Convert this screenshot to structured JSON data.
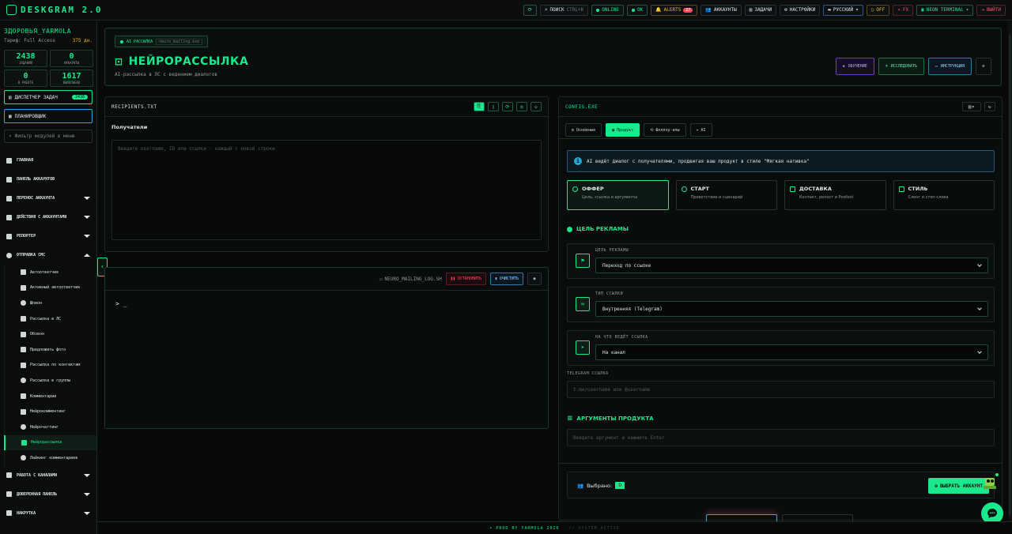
{
  "app": {
    "logo_text": "DESKGRAM 2.0",
    "brand_color": "#19e88d"
  },
  "topbar": {
    "search_label": "ПОИСК",
    "search_shortcut": "CTRL+K",
    "online_label": "ONLINE",
    "ok_label": "OK",
    "alerts_label": "ALERTS",
    "alerts_count": "27",
    "accounts_label": "АККАУНТЫ",
    "tasks_label": "ЗАДАЧИ",
    "settings_label": "НАСТРОЙКИ",
    "language_label": "РУССКИЙ",
    "off_label": "OFF",
    "fx_label": "FX",
    "theme_label": "NEON TERMINAL",
    "logout_label": "ВЫЙТИ"
  },
  "sidebar": {
    "user_name": "ЗДОРОВЬЯ_YARMOLA",
    "tariff": "Тариф: Full Access",
    "days": "375 дн.",
    "stats": [
      {
        "value": "2438",
        "label": "ЗАДАНИЙ"
      },
      {
        "value": "0",
        "label": "АККАУНТЫ"
      },
      {
        "value": "0",
        "label": "В РАБОТЕ"
      },
      {
        "value": "1617",
        "label": "ВЫПОЛНЕНО"
      }
    ],
    "dispatcher_label": "ДИСПЕТЧЕР ЗАДАЧ",
    "dispatcher_count": "2438",
    "planner_label": "ПЛАНИРОВЩИК",
    "filter_placeholder": "Фильтр модулей в меню",
    "nav": [
      {
        "label": "ГЛАВНАЯ",
        "icon": "home-icon"
      },
      {
        "label": "ПАНЕЛЬ АККАУНТОВ",
        "icon": "users-icon"
      },
      {
        "label": "ПЕРЕНОС АККАУНТА",
        "icon": "transfer-icon"
      },
      {
        "label": "ДЕЙСТВИЯ С АККАУНТАМИ",
        "icon": "users-cog-icon"
      },
      {
        "label": "РЕПОРТЕР",
        "icon": "flag-icon"
      },
      {
        "label": "ОТПРАВКА СМС",
        "icon": "chat-icon"
      }
    ],
    "sub": [
      {
        "label": "Автоответчик"
      },
      {
        "label": "Активный автоответчик"
      },
      {
        "label": "Шпион"
      },
      {
        "label": "Рассылка в ЛС"
      },
      {
        "label": "Обзвон"
      },
      {
        "label": "Предложить фото"
      },
      {
        "label": "Рассылка по контактам"
      },
      {
        "label": "Рассылка в группы"
      },
      {
        "label": "Комментарии"
      },
      {
        "label": "Нейрокомментинг"
      },
      {
        "label": "Нейрочаттинг"
      },
      {
        "label": "Нейрорассылка"
      },
      {
        "label": "Лайкинг комментариев"
      }
    ],
    "nav2": [
      {
        "label": "РАБОТА С КАНАЛАМИ"
      },
      {
        "label": "ДОВЕРЕННАЯ ПАНЕЛЬ"
      },
      {
        "label": "НАКРУТКА"
      }
    ]
  },
  "header": {
    "tag": "AI РАССЫЛКА",
    "file": "neuro_mailing.exe",
    "title": "НЕЙРОРАССЫЛКА",
    "subtitle": "AI-рассылка в ЛС с ведением диалогов",
    "btn_learn": "ОБУЧЕНИЕ",
    "btn_explore": "ИССЛЕДОВАТЬ",
    "btn_guide": "ИНСТРУКЦИЯ"
  },
  "recipients": {
    "file": "RECIPIENTS.TXT",
    "label": "Получатели",
    "placeholder": "Введите username, ID или ссылки - каждый с новой строки"
  },
  "log": {
    "file": "NEURO_MAILING_LOG.SH",
    "stop": "ОСТАНОВИТЬ",
    "clear": "ОЧИСТИТЬ",
    "prompt": "> _"
  },
  "config": {
    "file": "CONFIG.EXE",
    "tabs": [
      "Основные",
      "Продукт",
      "Фоллоу-апы",
      "AI"
    ],
    "info": "AI ведёт диалог с получателями, продвигая ваш продукт в стиле \"Мягкая нативка\"",
    "cards": [
      {
        "title": "ОФФЕР",
        "desc": "Цель, ссылка и аргументы"
      },
      {
        "title": "СТАРТ",
        "desc": "Приветствие и сценарий"
      },
      {
        "title": "ДОСТАВКА",
        "desc": "Контакт, репост и Postbot"
      },
      {
        "title": "СТИЛЬ",
        "desc": "Сленг и стоп-слова"
      }
    ],
    "section_goal": "ЦЕЛЬ РЕКЛАМЫ",
    "fields": [
      {
        "label": "ЦЕЛЬ РЕКЛАМЫ",
        "value": "Переход по ссылке"
      },
      {
        "label": "ТИП ССЫЛКИ",
        "value": "Внутренняя (Telegram)"
      },
      {
        "label": "НА ЧТО ВЕДЁТ ССЫЛКА",
        "value": "На канал"
      }
    ],
    "tg_label": "TELEGRAM ССЫЛКА",
    "tg_placeholder": "t.me/username или @username",
    "section_args": "АРГУМЕНТЫ ПРОДУКТА",
    "args_placeholder": "Введите аргумент и нажмите Enter",
    "selected_label": "Выбрано:",
    "selected_count": "0",
    "select_btn": "ВЫБРАТЬ АККАУНТ"
  },
  "footer": {
    "credit": "• PROD BY YARMOLA 2026",
    "status": "// SYSTEM ACTIVE"
  }
}
